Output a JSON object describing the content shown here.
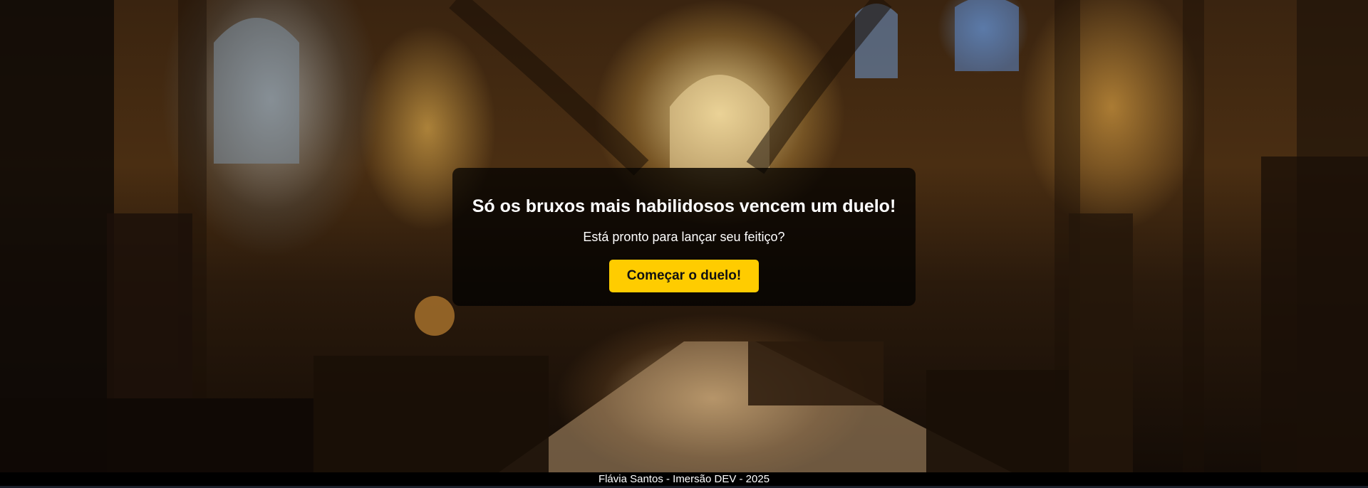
{
  "hero": {
    "title": "Só os bruxos mais habilidosos vencem um duelo!",
    "subtitle": "Está pronto para lançar seu feitiço?",
    "button_label": "Começar o duelo!"
  },
  "footer": {
    "text": "Flávia Santos - Imersão DEV - 2025"
  },
  "colors": {
    "button_bg": "#ffcc00",
    "card_bg": "rgba(0,0,0,0.72)",
    "text": "#ffffff"
  }
}
